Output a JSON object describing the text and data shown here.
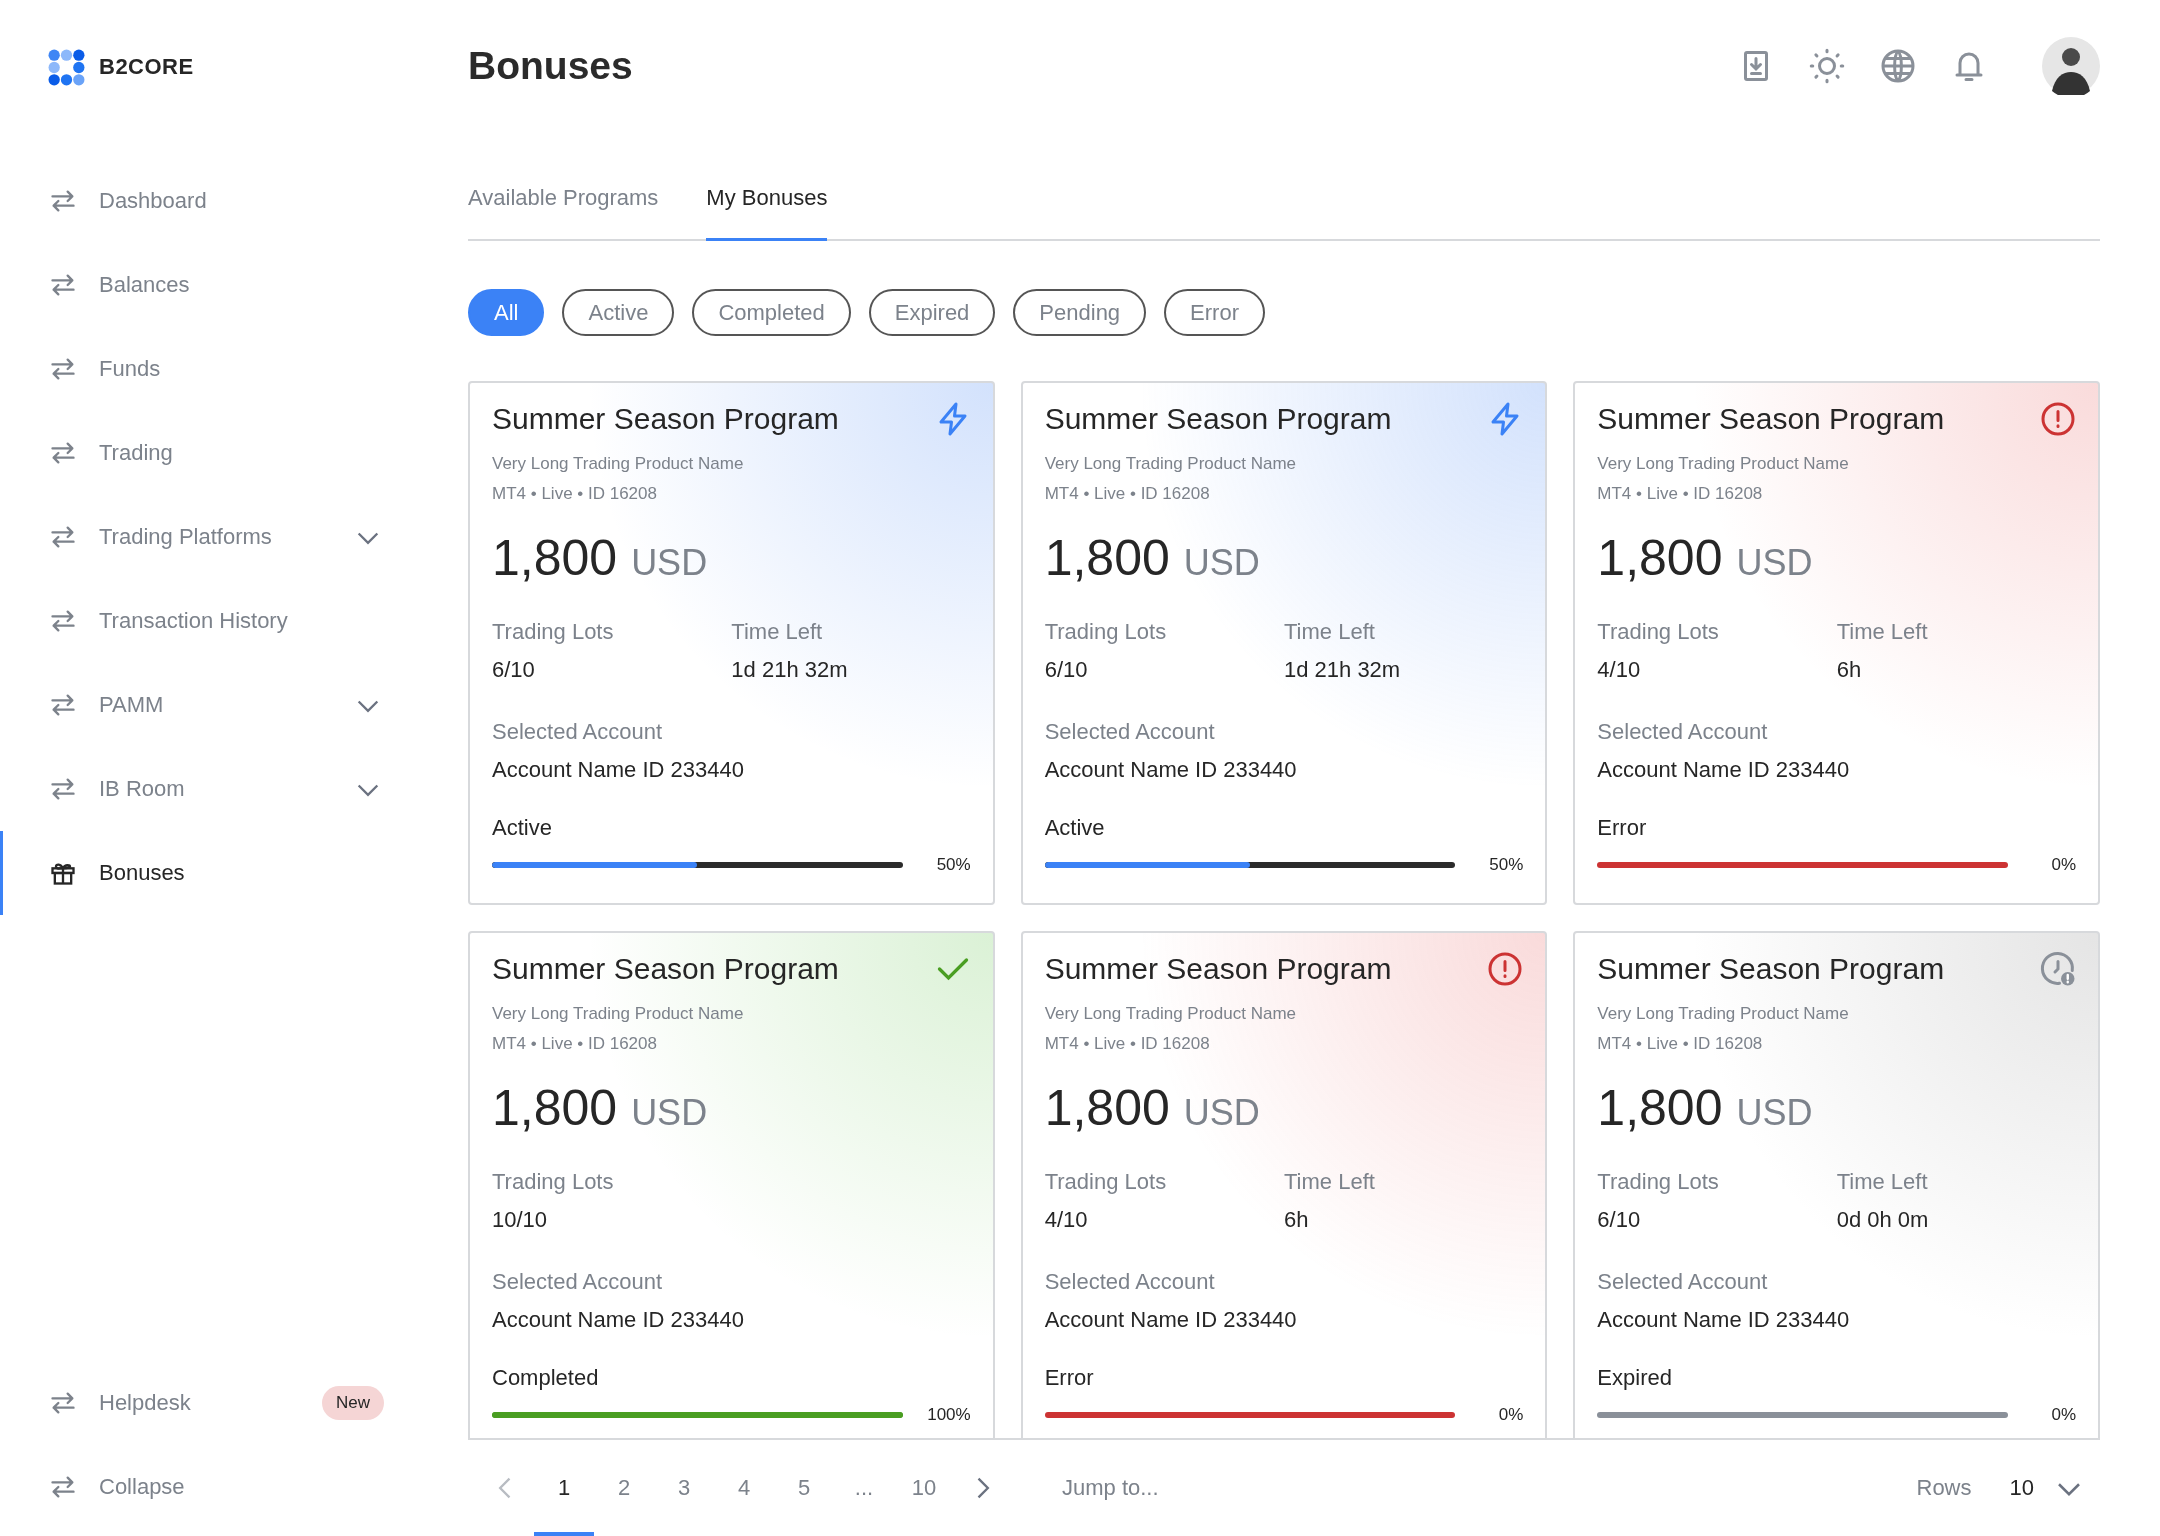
{
  "brand": {
    "name": "B2CORE"
  },
  "page": {
    "title": "Bonuses"
  },
  "sidebar": {
    "items": [
      {
        "label": "Dashboard",
        "kind": "arrows",
        "selected": false
      },
      {
        "label": "Balances",
        "kind": "arrows",
        "selected": false
      },
      {
        "label": "Funds",
        "kind": "arrows",
        "selected": false
      },
      {
        "label": "Trading",
        "kind": "arrows",
        "selected": false
      },
      {
        "label": "Trading Platforms",
        "kind": "arrows",
        "selected": false,
        "expanded": false
      },
      {
        "label": "Transaction History",
        "kind": "arrows",
        "selected": false
      },
      {
        "label": "PAMM",
        "kind": "arrows",
        "selected": false,
        "expanded": false
      },
      {
        "label": "IB Room",
        "kind": "arrows",
        "selected": false,
        "expanded": false
      },
      {
        "label": "Bonuses",
        "kind": "gift",
        "selected": true
      }
    ],
    "bottom_items": [
      {
        "label": "Helpdesk",
        "kind": "arrows",
        "selected": false,
        "badge": "New"
      },
      {
        "label": "Collapse",
        "kind": "arrows",
        "selected": false
      }
    ]
  },
  "tabs": [
    {
      "label": "Available Programs",
      "selected": false
    },
    {
      "label": "My Bonuses",
      "selected": true
    }
  ],
  "filters": [
    {
      "label": "All",
      "selected": true
    },
    {
      "label": "Active",
      "selected": false
    },
    {
      "label": "Completed",
      "selected": false
    },
    {
      "label": "Expired",
      "selected": false
    },
    {
      "label": "Pending",
      "selected": false
    },
    {
      "label": "Error",
      "selected": false
    }
  ],
  "cards": [
    {
      "title": "Summer Season Program",
      "product": "Very Long Trading Product Name",
      "meta": "MT4 • Live • ID 16208",
      "amount": "1,800",
      "currency": "USD",
      "lots_label": "Trading Lots",
      "lots": "6/10",
      "time_label": "Time Left",
      "time": "1d 21h 32m",
      "account_label": "Selected Account",
      "account": "Account Name ID 233440",
      "status": "Active",
      "kind": "active",
      "level": 0.5,
      "percent": "50%"
    },
    {
      "title": "Summer Season Program",
      "product": "Very Long Trading Product Name",
      "meta": "MT4 • Live • ID 16208",
      "amount": "1,800",
      "currency": "USD",
      "lots_label": "Trading Lots",
      "lots": "6/10",
      "time_label": "Time Left",
      "time": "1d 21h 32m",
      "account_label": "Selected Account",
      "account": "Account Name ID 233440",
      "status": "Active",
      "kind": "active",
      "level": 0.5,
      "percent": "50%"
    },
    {
      "title": "Summer Season Program",
      "product": "Very Long Trading Product Name",
      "meta": "MT4 • Live • ID 16208",
      "amount": "1,800",
      "currency": "USD",
      "lots_label": "Trading Lots",
      "lots": "4/10",
      "time_label": "Time Left",
      "time": "6h",
      "account_label": "Selected Account",
      "account": "Account Name ID 233440",
      "status": "Error",
      "kind": "error",
      "level": 0,
      "percent": "0%"
    },
    {
      "title": "Summer Season Program",
      "product": "Very Long Trading Product Name",
      "meta": "MT4 • Live • ID 16208",
      "amount": "1,800",
      "currency": "USD",
      "lots_label": "Trading Lots",
      "lots": "10/10",
      "account_label": "Selected Account",
      "account": "Account Name ID 233440",
      "status": "Completed",
      "kind": "completed",
      "level": 1,
      "percent": "100%"
    },
    {
      "title": "Summer Season Program",
      "product": "Very Long Trading Product Name",
      "meta": "MT4 • Live • ID 16208",
      "amount": "1,800",
      "currency": "USD",
      "lots_label": "Trading Lots",
      "lots": "4/10",
      "time_label": "Time Left",
      "time": "6h",
      "account_label": "Selected Account",
      "account": "Account Name ID 233440",
      "status": "Error",
      "kind": "error",
      "level": 0,
      "percent": "0%"
    },
    {
      "title": "Summer Season Program",
      "product": "Very Long Trading Product Name",
      "meta": "MT4 • Live • ID 16208",
      "amount": "1,800",
      "currency": "USD",
      "lots_label": "Trading Lots",
      "lots": "6/10",
      "time_label": "Time Left",
      "time": "0d 0h 0m",
      "account_label": "Selected Account",
      "account": "Account Name ID 233440",
      "status": "Expired",
      "kind": "expired",
      "level": 0,
      "percent": "0%"
    }
  ],
  "pagination": {
    "pages": [
      {
        "label": "1",
        "selected": true
      },
      {
        "label": "2",
        "selected": false
      },
      {
        "label": "3",
        "selected": false
      },
      {
        "label": "4",
        "selected": false
      },
      {
        "label": "5",
        "selected": false
      },
      {
        "label": "...",
        "selected": false
      },
      {
        "label": "10",
        "selected": false
      }
    ],
    "jump": {
      "placeholder": "Jump to..."
    },
    "rows_label": "Rows",
    "rows": "10"
  }
}
